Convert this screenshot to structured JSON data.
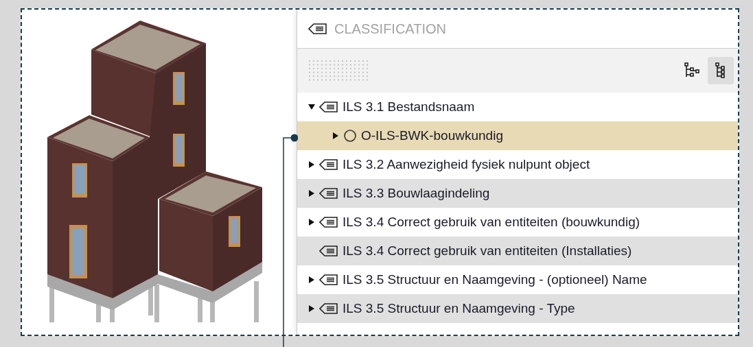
{
  "panel": {
    "title": "CLASSIFICATION",
    "toolbar_buttons": [
      {
        "kind": "tree-branches",
        "selected": false
      },
      {
        "kind": "tree-list",
        "selected": true
      }
    ],
    "tree": [
      {
        "kind": "classification",
        "label": "ILS 3.1 Bestandsnaam",
        "expandable": true,
        "expanded": true,
        "selected": false,
        "children": [
          {
            "kind": "reference",
            "label": "O-ILS-BWK-bouwkundig",
            "expandable": true,
            "expanded": false,
            "selected": true
          }
        ]
      },
      {
        "kind": "classification",
        "label": "ILS 3.2 Aanwezigheid fysiek nulpunt object",
        "expandable": true,
        "expanded": false,
        "selected": false
      },
      {
        "kind": "classification",
        "label": "ILS 3.3 Bouwlaagindeling",
        "expandable": true,
        "expanded": false,
        "selected": false
      },
      {
        "kind": "classification",
        "label": "ILS 3.4 Correct gebruik van entiteiten (bouwkundig)",
        "expandable": true,
        "expanded": false,
        "selected": false
      },
      {
        "kind": "classification",
        "label": "ILS 3.4 Correct gebruik van entiteiten (Installaties)",
        "selected": false
      },
      {
        "kind": "classification",
        "label": "ILS 3.5 Structuur en Naamgeving - (optioneel) Name",
        "expandable": true,
        "expanded": false,
        "selected": false
      },
      {
        "kind": "classification",
        "label": "ILS 3.5 Structuur en Naamgeving - Type",
        "expandable": true,
        "expanded": false,
        "selected": false
      }
    ]
  }
}
